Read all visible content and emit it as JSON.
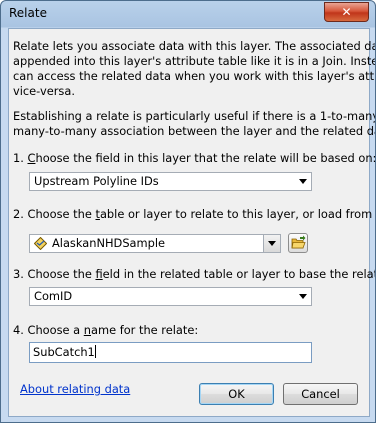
{
  "window": {
    "title": "Relate",
    "close_label": "✕"
  },
  "intro": {
    "line1": "Relate lets you associate data with this layer. The associated data isn't",
    "line2": "appended into this layer's attribute table like it is in a Join. Instead you",
    "line3": "can access the related data when you work with this layer's attributes or",
    "line4": "vice-versa."
  },
  "note": {
    "line1": "Establishing a relate is particularly useful if there is a 1-to-many or",
    "line2": "many-to-many association between the layer and the related data."
  },
  "step1": {
    "pre": "1. ",
    "key": "C",
    "post": "hoose the field in this layer that the relate will be based on:",
    "value": "Upstream Polyline IDs"
  },
  "step2": {
    "pre": "2. Choose the ",
    "key": "t",
    "post": "able or layer to relate to this layer, or load from disk:",
    "value": "AlaskanNHDSample",
    "icon": "layer-icon",
    "browse_icon": "open-folder-icon"
  },
  "step3": {
    "pre": "3. Choose the ",
    "key": "f",
    "post": "ield in the related table or layer to base the relate on:",
    "value": "ComID"
  },
  "step4": {
    "pre": "4. Choose a ",
    "key": "n",
    "post": "ame for the relate:",
    "value": "SubCatch1"
  },
  "footer": {
    "about_link": "About relating data",
    "ok_label": "OK",
    "cancel_label": "Cancel"
  }
}
